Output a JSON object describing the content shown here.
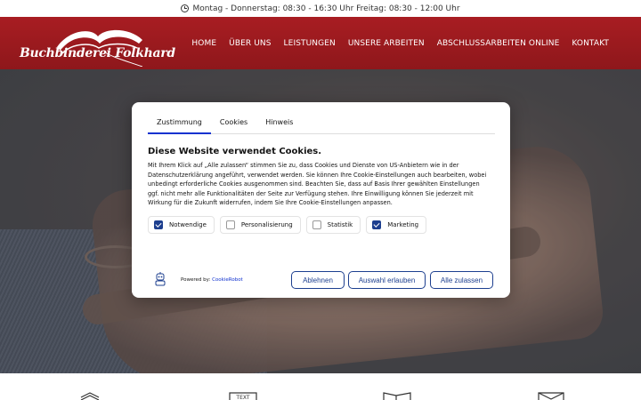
{
  "topbar": {
    "hours": "Montag - Donnerstag: 08:30 - 16:30 Uhr Freitag: 08:30 - 12:00 Uhr",
    "icon": "clock-icon"
  },
  "header": {
    "logo_text": "Buchbinderei Folkhard",
    "nav": [
      "HOME",
      "ÜBER UNS",
      "LEISTUNGEN",
      "UNSERE ARBEITEN",
      "ABSCHLUSSARBEITEN ONLINE",
      "KONTAKT"
    ],
    "brand_color": "#9e1b1f"
  },
  "cookie_dialog": {
    "tabs": [
      "Zustimmung",
      "Cookies",
      "Hinweis"
    ],
    "active_tab": "Zustimmung",
    "title": "Diese Website verwendet Cookies.",
    "text": "Mit Ihrem Klick auf „Alle zulassen“ stimmen Sie zu, dass Cookies und Dienste von US-Anbietern wie in der Datenschutzerklärung angeführt, verwendet werden. Sie können Ihre Cookie-Einstellungen auch bearbeiten, wobei unbedingt erforderliche Cookies ausgenommen sind. Beachten Sie, dass auf Basis Ihrer gewählten Einstellungen ggf. nicht mehr alle Funktionalitäten der Seite zur Verfügung stehen. Ihre Einwilligung können Sie jederzeit mit Wirkung für die Zukunft widerrufen, indem Sie Ihre Cookie-Einstellungen anpassen.",
    "options": [
      {
        "label": "Notwendige",
        "checked": true
      },
      {
        "label": "Personalisierung",
        "checked": false
      },
      {
        "label": "Statistik",
        "checked": false
      },
      {
        "label": "Marketing",
        "checked": true
      }
    ],
    "powered_prefix": "Powered by:",
    "powered_link": "CookieRobot",
    "buttons": {
      "decline": "Ablehnen",
      "allow_selection": "Auswahl erlauben",
      "allow_all": "Alle zulassen"
    },
    "accent_color": "#1d3f8f"
  }
}
